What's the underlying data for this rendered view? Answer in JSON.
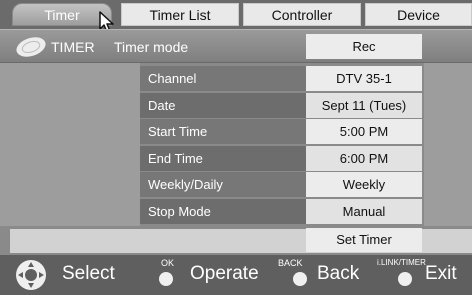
{
  "tabs": [
    {
      "label": "Timer",
      "active": true
    },
    {
      "label": "Timer List",
      "active": false
    },
    {
      "label": "Controller",
      "active": false
    },
    {
      "label": "Device",
      "active": false
    }
  ],
  "header": {
    "title": "TIMER",
    "subtitle": "Timer mode",
    "mode_value": "Rec"
  },
  "settings": [
    {
      "label": "Channel",
      "value": "DTV 35-1"
    },
    {
      "label": "Date",
      "value": "Sept 11 (Tues)"
    },
    {
      "label": "Start Time",
      "value": "5:00 PM"
    },
    {
      "label": "End Time",
      "value": "6:00 PM"
    },
    {
      "label": "Weekly/Daily",
      "value": "Weekly"
    },
    {
      "label": "Stop Mode",
      "value": "Manual"
    }
  ],
  "set_timer_label": "Set Timer",
  "footer": {
    "select_label": "Select",
    "ok_caption": "OK",
    "operate_label": "Operate",
    "back_caption": "BACK",
    "back_label": "Back",
    "exit_caption": "i.LINK/TIMER",
    "exit_label": "Exit"
  },
  "icons": {
    "cursor": "mouse-pointer-icon",
    "timer": "timer-disc-icon",
    "dpad": "dpad-icon"
  }
}
